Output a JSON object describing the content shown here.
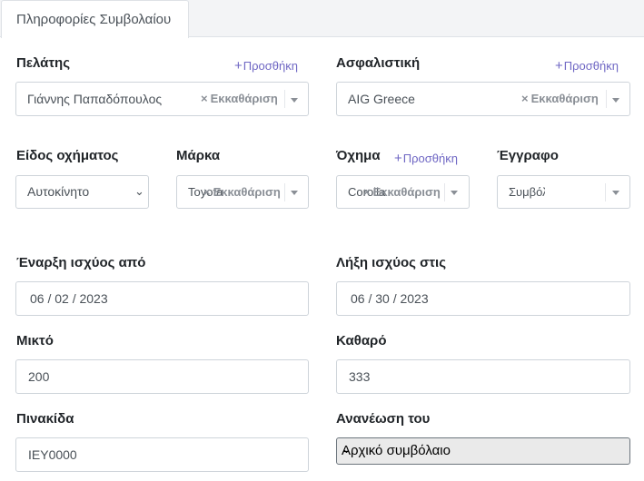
{
  "tab": {
    "label": "Πληροφορίες Συμβολαίου"
  },
  "customer": {
    "label": "Πελάτης",
    "add": "Προσθήκη",
    "value": "Γιάννης Παπαδόπουλος",
    "clear": "Εκκαθάριση"
  },
  "insurer": {
    "label": "Ασφαλιστική",
    "add": "Προσθήκη",
    "value": "AIG Greece",
    "clear": "Εκκαθάριση"
  },
  "vehicle_type": {
    "label": "Είδος οχήματος",
    "value": "Αυτοκίνητο"
  },
  "brand": {
    "label": "Μάρκα",
    "value": "Toyota",
    "clear": "Εκκαθάριση"
  },
  "vehicle": {
    "label": "Όχημα",
    "add": "Προσθήκη",
    "value": "Corolla",
    "clear": "Εκκαθάριση"
  },
  "document": {
    "label": "Έγγραφο",
    "value": "Συμβόλαιο"
  },
  "start_date": {
    "label": "Έναρξη ισχύος από",
    "value": "06 / 02 / 2023"
  },
  "end_date": {
    "label": "Λήξη ισχύος στις",
    "value": "06 / 30 / 2023"
  },
  "gross": {
    "label": "Μικτό",
    "value": "200"
  },
  "net": {
    "label": "Καθαρό",
    "value": "333"
  },
  "plate": {
    "label": "Πινακίδα",
    "value": "ΙΕΥ0000"
  },
  "renewal": {
    "label": "Ανανέωση του",
    "value": "Αρχικό συμβόλαιο"
  }
}
